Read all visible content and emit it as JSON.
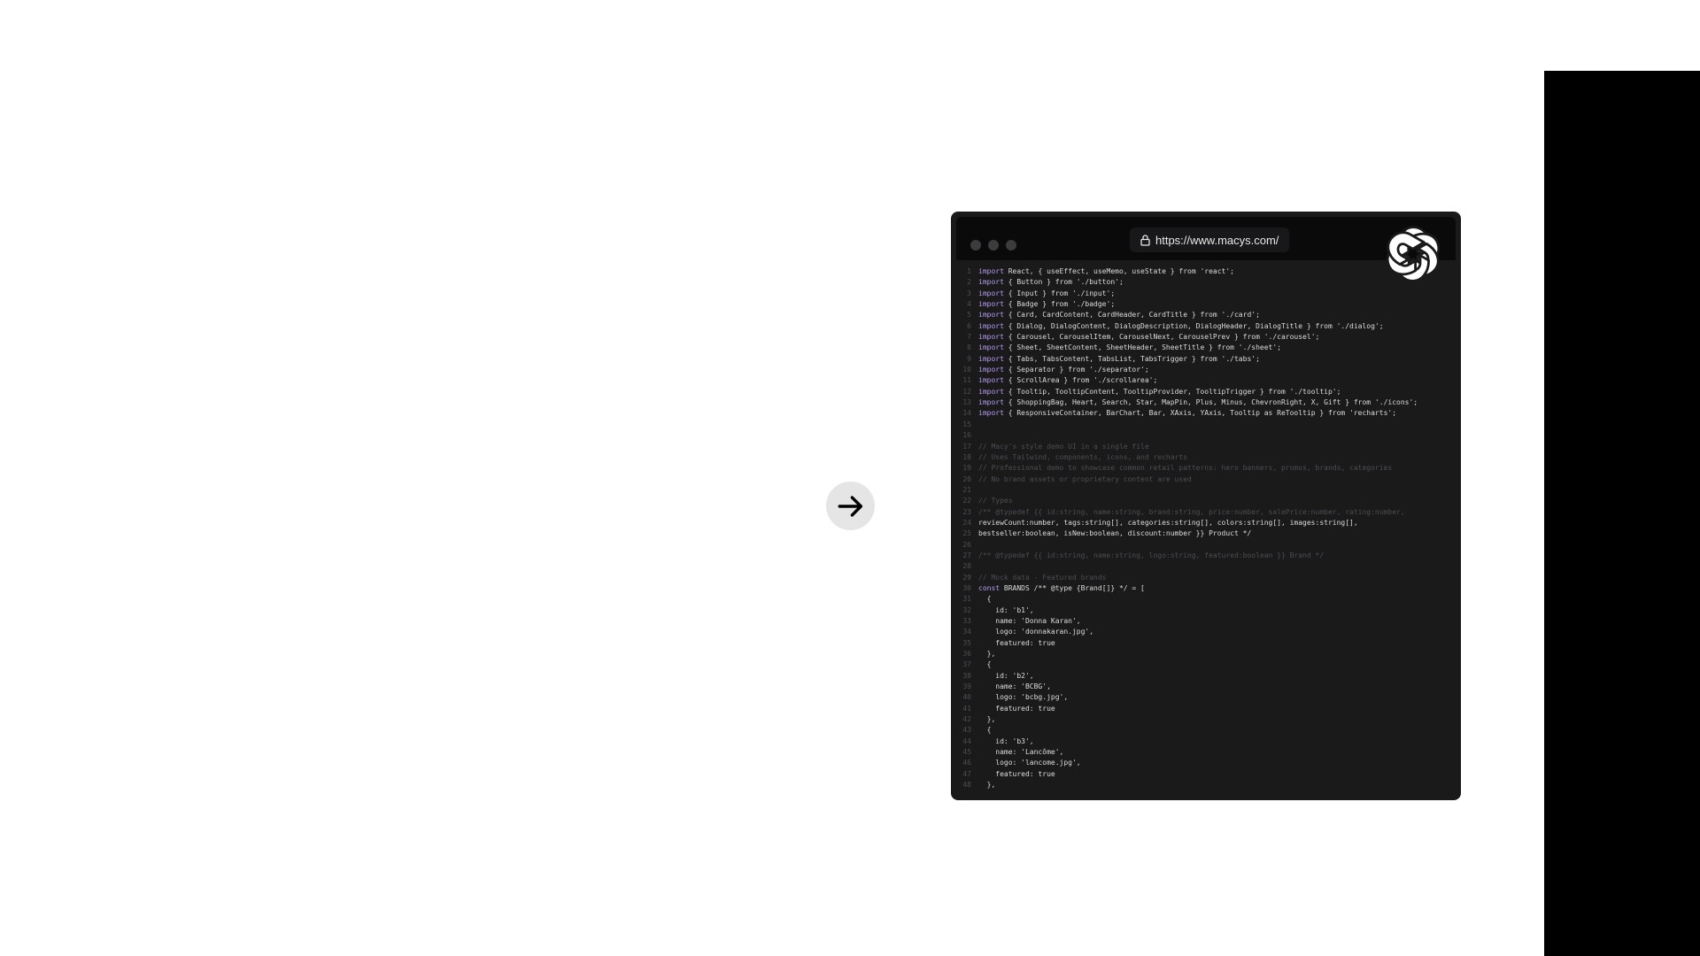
{
  "browser": {
    "url": "https://www.macys.com/",
    "line_numbers": [
      "1",
      "2",
      "3",
      "4",
      "5",
      "6",
      "7",
      "8",
      "9",
      "10",
      "11",
      "12",
      "13",
      "14",
      "15",
      "16",
      "17",
      "18",
      "19",
      "20",
      "21",
      "22",
      "23",
      "24",
      "25",
      "26",
      "27",
      "28",
      "29",
      "30",
      "31",
      "32",
      "33",
      "34",
      "35",
      "36",
      "37",
      "38",
      "39",
      "40",
      "41",
      "42",
      "43",
      "44",
      "45",
      "46",
      "47",
      "48"
    ],
    "code_lines": [
      [
        "import",
        " React, { useEffect, useMemo, useState } from 'react';"
      ],
      [
        "import",
        " { Button } from './button';"
      ],
      [
        "import",
        " { Input } from './input';"
      ],
      [
        "import",
        " { Badge } from './badge';"
      ],
      [
        "import",
        " { Card, CardContent, CardHeader, CardTitle } from './card';"
      ],
      [
        "import",
        " { Dialog, DialogContent, DialogDescription, DialogHeader, DialogTitle } from './dialog';"
      ],
      [
        "import",
        " { Carousel, CarouselItem, CarouselNext, CarouselPrev } from './carousel';"
      ],
      [
        "import",
        " { Sheet, SheetContent, SheetHeader, SheetTitle } from './sheet';"
      ],
      [
        "import",
        " { Tabs, TabsContent, TabsList, TabsTrigger } from './tabs';"
      ],
      [
        "import",
        " { Separator } from './separator';"
      ],
      [
        "import",
        " { ScrollArea } from './scrollarea';"
      ],
      [
        "import",
        " { Tooltip, TooltipContent, TooltipProvider, TooltipTrigger } from './tooltip';"
      ],
      [
        "import",
        " { ShoppingBag, Heart, Search, Star, MapPin, Plus, Minus, ChevronRight, X, Gift } from './icons';"
      ],
      [
        "import",
        " { ResponsiveContainer, BarChart, Bar, XAxis, YAxis, Tooltip as ReTooltip } from 'recharts';"
      ],
      [
        "",
        ""
      ],
      [
        "",
        ""
      ],
      [
        "// Macy's style demo UI in a single file",
        ""
      ],
      [
        "// Uses Tailwind, components, icons, and recharts",
        ""
      ],
      [
        "// Professional demo to showcase common retail patterns: hero banners, promos, brands, categories",
        ""
      ],
      [
        "// No brand assets or proprietary content are used",
        ""
      ],
      [
        "",
        ""
      ],
      [
        "// Types",
        ""
      ],
      [
        "/** @typedef {{ id:string, name:string, brand:string, price:number, salePrice:number, rating:number,",
        ""
      ],
      [
        "",
        "reviewCount:number, tags:string[], categories:string[], colors:string[], images:string[],"
      ],
      [
        "",
        "bestseller:boolean, isNew:boolean, discount:number }} Product */"
      ],
      [
        "",
        ""
      ],
      [
        "/** @typedef {{ id:string, name:string, logo:string, featured:boolean }} Brand */",
        ""
      ],
      [
        "",
        ""
      ],
      [
        "// Mock data - Featured brands",
        ""
      ],
      [
        "const",
        " BRANDS /** @type {Brand[]} */ = ["
      ],
      [
        "",
        "  {"
      ],
      [
        "",
        "    id: 'b1',"
      ],
      [
        "",
        "    name: 'Donna Karan',"
      ],
      [
        "",
        "    logo: 'donnakaran.jpg',"
      ],
      [
        "",
        "    featured: true"
      ],
      [
        "",
        "  },"
      ],
      [
        "",
        "  {"
      ],
      [
        "",
        "    id: 'b2',"
      ],
      [
        "",
        "    name: 'BCBG',"
      ],
      [
        "",
        "    logo: 'bcbg.jpg',"
      ],
      [
        "",
        "    featured: true"
      ],
      [
        "",
        "  },"
      ],
      [
        "",
        "  {"
      ],
      [
        "",
        "    id: 'b3',"
      ],
      [
        "",
        "    name: 'Lancôme',"
      ],
      [
        "",
        "    logo: 'lancome.jpg',"
      ],
      [
        "",
        "    featured: true"
      ],
      [
        "",
        "  },"
      ]
    ]
  },
  "icons": {
    "arrow": "arrow-right-icon",
    "lock": "lock-icon",
    "logo": "openai-logo-icon"
  },
  "colors": {
    "browser_bg": "#1a1a1b",
    "titlebar_bg": "#0a0a0a",
    "keyword": "#b59cf0",
    "comment": "#4d4d52",
    "right_panel": "#000000"
  }
}
